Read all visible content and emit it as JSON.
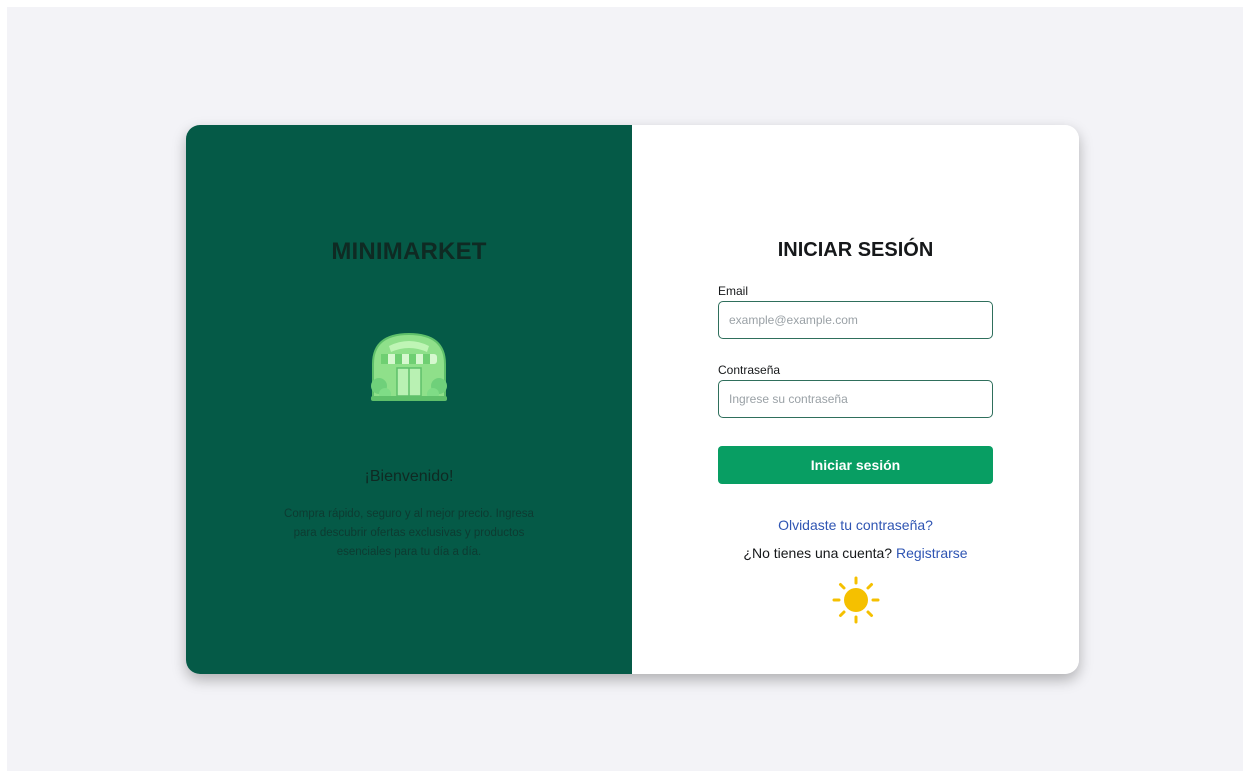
{
  "brand": {
    "name": "MINIMARKET",
    "logo_icon": "store-icon"
  },
  "welcome": {
    "heading": "¡Bienvenido!",
    "description": "Compra rápido, seguro y al mejor precio. Ingresa para descubrir ofertas exclusivas y productos esenciales para tu día a día."
  },
  "login": {
    "title": "INICIAR SESIÓN",
    "email_label": "Email",
    "email_placeholder": "example@example.com",
    "email_value": "",
    "password_label": "Contraseña",
    "password_placeholder": "Ingrese su contraseña",
    "password_value": "",
    "submit_label": "Iniciar sesión",
    "forgot_link": "Olvidaste tu contraseña?",
    "signup_prompt": "¿No tienes una cuenta?",
    "signup_link": "Registrarse",
    "theme_toggle_icon": "sun-icon"
  },
  "colors": {
    "left_panel": "#055a47",
    "primary_button": "#089e63",
    "link": "#2f55b3",
    "page_background": "#f3f3f7",
    "sun": "#f5c000"
  }
}
